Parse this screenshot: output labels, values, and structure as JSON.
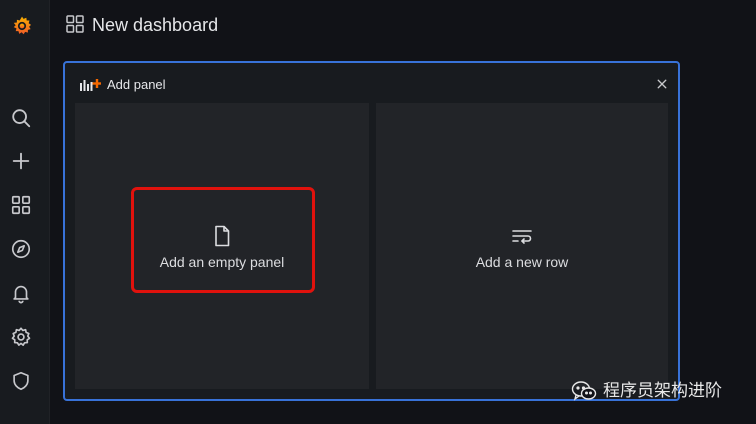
{
  "app": {
    "title": "New dashboard"
  },
  "sidebar": {
    "items": [
      {
        "name": "grafana-logo",
        "interactable": true
      },
      {
        "name": "search",
        "interactable": true
      },
      {
        "name": "create",
        "interactable": true
      },
      {
        "name": "dashboards",
        "interactable": true
      },
      {
        "name": "explore",
        "interactable": true
      },
      {
        "name": "alerting",
        "interactable": true
      },
      {
        "name": "configuration",
        "interactable": true
      },
      {
        "name": "server-admin",
        "interactable": true
      }
    ]
  },
  "modal": {
    "title": "Add panel",
    "close_symbol": "×",
    "options": [
      {
        "label": "Add an empty panel",
        "icon": "file-icon"
      },
      {
        "label": "Add a new row",
        "icon": "row-icon"
      }
    ]
  },
  "watermark": {
    "text": "程序员架构进阶"
  },
  "colors": {
    "background": "#111217",
    "sidebar": "#181b1f",
    "card": "#222428",
    "modal_border": "#3872d8",
    "highlight": "#e1120d",
    "logo_orange": "#f46800"
  }
}
